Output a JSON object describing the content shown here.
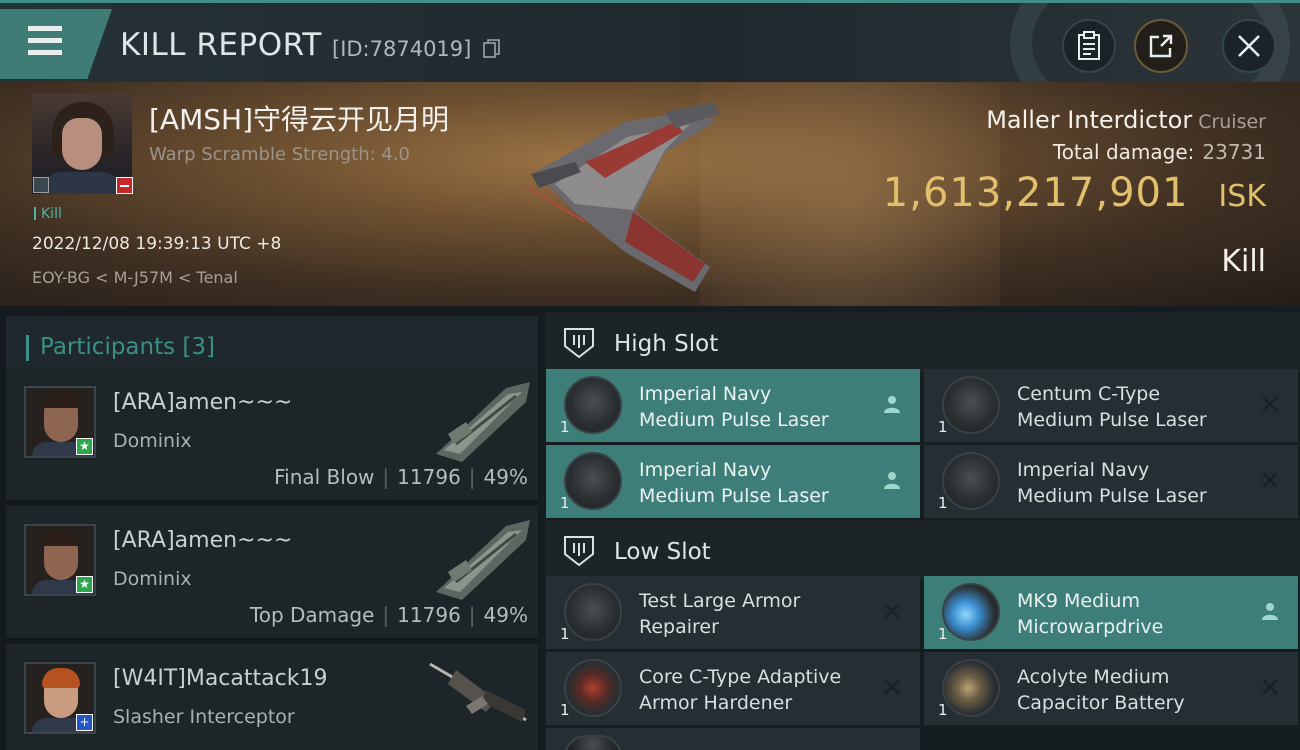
{
  "header": {
    "title": "KILL REPORT",
    "id_text": "[ID:7874019]"
  },
  "victim": {
    "name": "[AMSH]守得云开见月明",
    "warp_scramble": "Warp Scramble Strength: 4.0",
    "tag": "Kill",
    "datetime": "2022/12/08 19:39:13 UTC +8",
    "location": "EOY-BG < M-J57M < Tenal",
    "ship_name": "Maller Interdictor",
    "ship_class": "Cruiser",
    "total_damage_label": "Total damage:",
    "total_damage": "23731",
    "isk_value": "1,613,217,901",
    "isk_unit": "ISK",
    "result": "Kill"
  },
  "participants": {
    "label": "Participants",
    "count": "[3]",
    "rows": [
      {
        "name": "[ARA]amen~~~",
        "ship": "Dominix",
        "role": "Final Blow",
        "damage": "11796",
        "percent": "49%"
      },
      {
        "name": "[ARA]amen~~~",
        "ship": "Dominix",
        "role": "Top Damage",
        "damage": "11796",
        "percent": "49%"
      },
      {
        "name": "[W4IT]Macattack19",
        "ship": "Slasher Interceptor"
      }
    ]
  },
  "fitting": {
    "high_label": "High Slot",
    "low_label": "Low Slot",
    "high": [
      {
        "line1": "Imperial Navy",
        "line2": "Medium Pulse Laser",
        "qty": "1"
      },
      {
        "line1": "Centum C-Type",
        "line2": "Medium Pulse Laser",
        "qty": "1"
      },
      {
        "line1": "Imperial Navy",
        "line2": "Medium Pulse Laser",
        "qty": "1"
      },
      {
        "line1": "Imperial Navy",
        "line2": "Medium Pulse Laser",
        "qty": "1"
      }
    ],
    "low": [
      {
        "line1": "Test Large Armor",
        "line2": "Repairer",
        "qty": "1"
      },
      {
        "line1": "MK9 Medium",
        "line2": "Microwarpdrive",
        "qty": "1"
      },
      {
        "line1": "Core C-Type Adaptive",
        "line2": " Armor Hardener",
        "qty": "1"
      },
      {
        "line1": "Acolyte Medium",
        "line2": "Capacitor Battery",
        "qty": "1"
      }
    ]
  },
  "colors": {
    "accent_teal": "#3c8f86",
    "isk_gold": "#e2bf6a",
    "negative_red": "#c5282a"
  }
}
